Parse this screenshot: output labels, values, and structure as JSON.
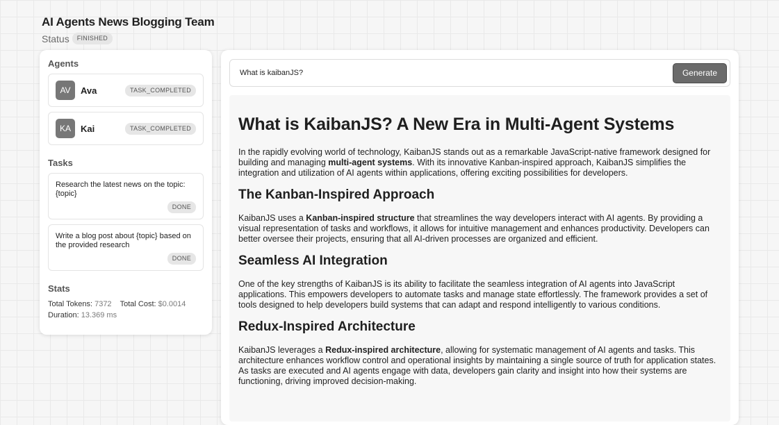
{
  "header": {
    "title": "AI Agents News Blogging Team",
    "status_label": "Status",
    "status_value": "FINISHED"
  },
  "agents_section": {
    "title": "Agents",
    "agents": [
      {
        "initials": "AV",
        "name": "Ava",
        "status": "TASK_COMPLETED"
      },
      {
        "initials": "KA",
        "name": "Kai",
        "status": "TASK_COMPLETED"
      }
    ]
  },
  "tasks_section": {
    "title": "Tasks",
    "tasks": [
      {
        "description": "Research the latest news on the topic: {topic}",
        "status": "DONE"
      },
      {
        "description": "Write a blog post about {topic} based on the provided research",
        "status": "DONE"
      }
    ]
  },
  "stats": {
    "title": "Stats",
    "tokens_label": "Total Tokens:",
    "tokens_value": "7372",
    "cost_label": "Total Cost:",
    "cost_value": "$0.0014",
    "duration_label": "Duration:",
    "duration_value": "13.369 ms"
  },
  "topic_input": {
    "value": "What is kaibanJS?"
  },
  "generate_label": "Generate",
  "article": {
    "title": "What is KaibanJS? A New Era in Multi-Agent Systems",
    "intro": {
      "pre": "In the rapidly evolving world of technology, KaibanJS stands out as a remarkable JavaScript-native framework designed for building and managing ",
      "bold": "multi-agent systems",
      "post": ". With its innovative Kanban-inspired approach, KaibanJS simplifies the integration and utilization of AI agents within applications, offering exciting possibilities for developers."
    },
    "sections": [
      {
        "heading": "The Kanban-Inspired Approach",
        "pre": "KaibanJS uses a ",
        "bold": "Kanban-inspired structure",
        "post": " that streamlines the way developers interact with AI agents. By providing a visual representation of tasks and workflows, it allows for intuitive management and enhances productivity. Developers can better oversee their projects, ensuring that all AI-driven processes are organized and efficient."
      },
      {
        "heading": "Seamless AI Integration",
        "pre": "One of the key strengths of KaibanJS is its ability to facilitate the seamless integration of AI agents into JavaScript applications. This empowers developers to automate tasks and manage state effortlessly. The framework provides a set of tools designed to help developers build systems that can adapt and respond intelligently to various conditions.",
        "bold": "",
        "post": ""
      },
      {
        "heading": "Redux-Inspired Architecture",
        "pre": "KaibanJS leverages a ",
        "bold": "Redux-inspired architecture",
        "post": ", allowing for systematic management of AI agents and tasks. This architecture enhances workflow control and operational insights by maintaining a single source of truth for application states. As tasks are executed and AI agents engage with data, developers gain clarity and insight into how their systems are functioning, driving improved decision-making."
      }
    ]
  }
}
